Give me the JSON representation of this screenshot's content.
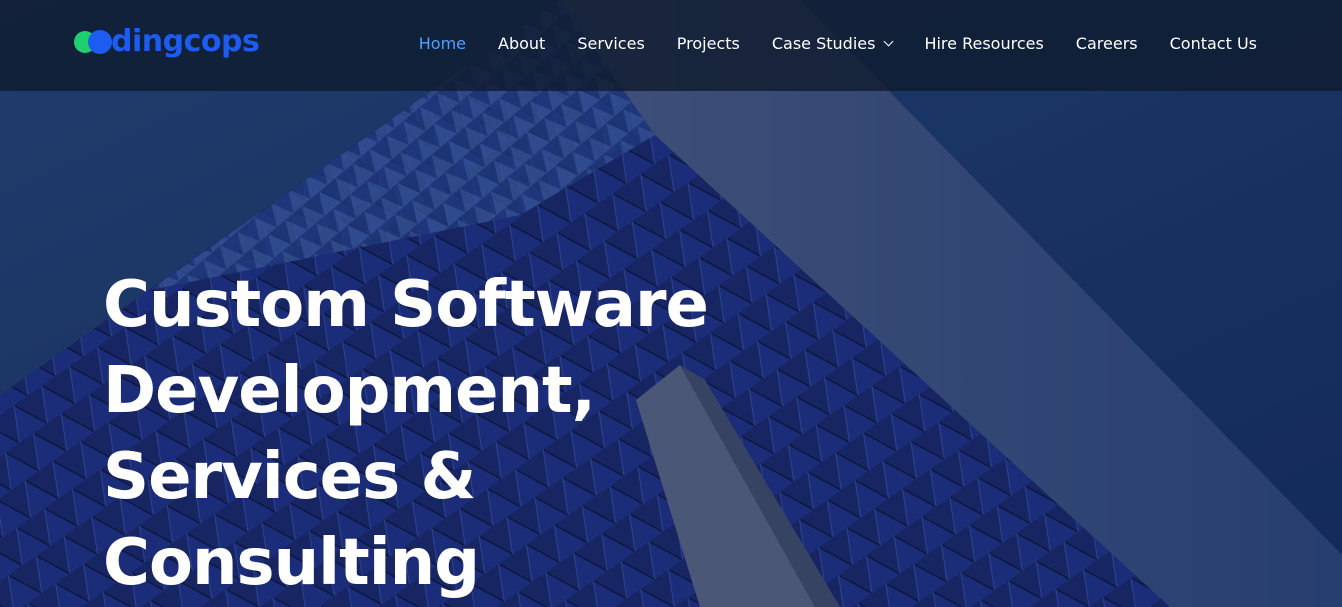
{
  "header": {
    "logo_text": "dingcops",
    "nav": [
      {
        "label": "Home",
        "active": true,
        "has_dropdown": false
      },
      {
        "label": "About",
        "active": false,
        "has_dropdown": false
      },
      {
        "label": "Services",
        "active": false,
        "has_dropdown": false
      },
      {
        "label": "Projects",
        "active": false,
        "has_dropdown": false
      },
      {
        "label": "Case Studies",
        "active": false,
        "has_dropdown": true
      },
      {
        "label": "Hire Resources",
        "active": false,
        "has_dropdown": false
      },
      {
        "label": "Careers",
        "active": false,
        "has_dropdown": false
      },
      {
        "label": "Contact Us",
        "active": false,
        "has_dropdown": false
      }
    ]
  },
  "hero": {
    "headline_lines": [
      "Custom Software",
      "Development,",
      "Services &",
      "Consulting"
    ]
  },
  "colors": {
    "brand_blue": "#1d5cf0",
    "brand_green": "#1fd16e",
    "nav_active": "#4ea1ff",
    "header_bg": "#101c30",
    "hero_bg": "#1b3868"
  }
}
